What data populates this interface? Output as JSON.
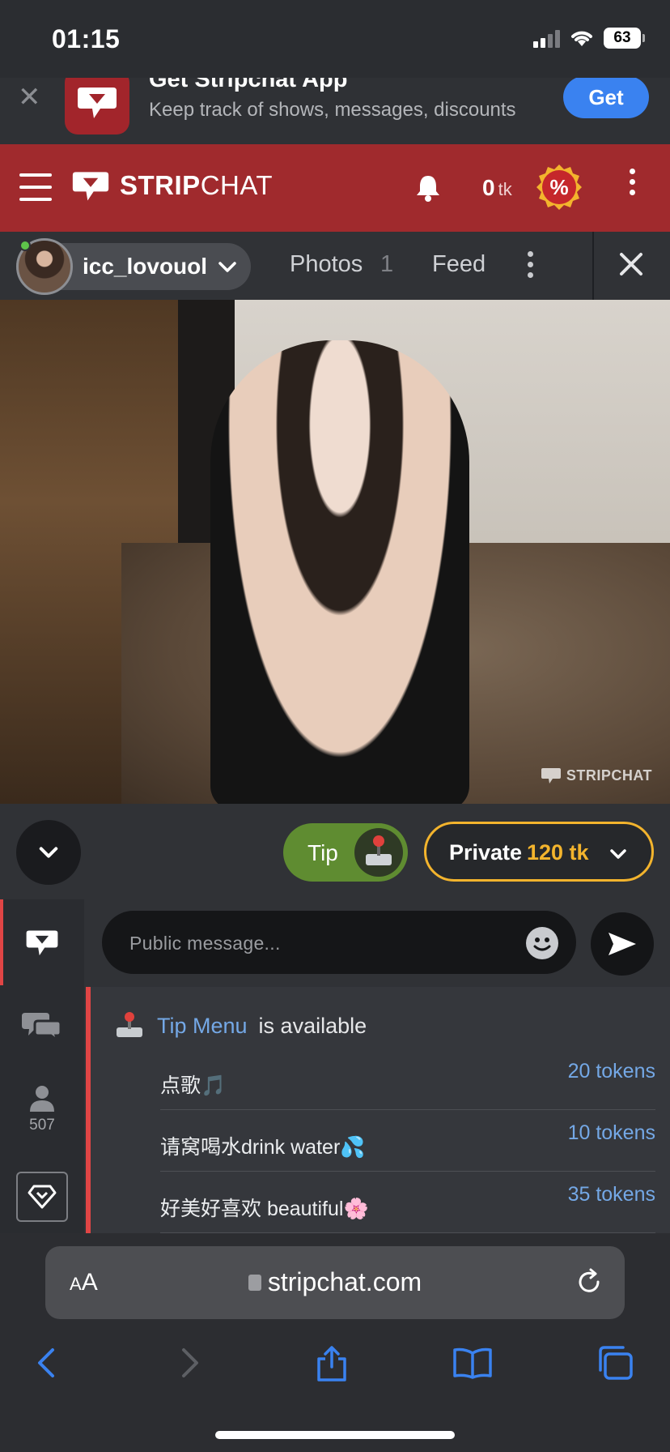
{
  "status_bar": {
    "time": "01:15",
    "battery": "63"
  },
  "app_banner": {
    "close_glyph": "✕",
    "title": "Get Stripchat App",
    "subtitle": "Keep track of shows, messages, discounts",
    "get_label": "Get"
  },
  "header": {
    "brand_bold": "STRIP",
    "brand_rest": "CHAT",
    "tokens_value": "0",
    "tokens_unit": "tk",
    "promo_symbol": "%"
  },
  "model_bar": {
    "model_name": "icc_lovouol",
    "tab_photos": "Photos",
    "tab_photos_count": "1",
    "tab_feed": "Feed"
  },
  "video": {
    "watermark": "STRIPCHAT"
  },
  "actions": {
    "tip_label": "Tip",
    "private_label": "Private",
    "private_price": "120 tk"
  },
  "chat": {
    "users_count": "507",
    "placeholder": "Public message...",
    "tip_menu": {
      "link_text": "Tip Menu",
      "rest_text": "is available",
      "items": [
        {
          "name": "点歌🎵",
          "price": "20 tokens"
        },
        {
          "name": "请窝喝水drink water💦",
          "price": "10 tokens"
        },
        {
          "name": "好美好喜欢 beautiful🌸",
          "price": "35 tokens"
        }
      ]
    }
  },
  "safari": {
    "aa_small": "A",
    "aa_large": "A",
    "url": "stripchat.com"
  },
  "colors": {
    "brand_red": "#a02a2d",
    "tip_green": "#5f8c31",
    "private_gold": "#f3b42d",
    "link_blue": "#74a8e6",
    "ios_blue": "#3a82f0"
  },
  "icons": [
    "close-icon",
    "stripchat-logo-icon",
    "menu-icon",
    "bell-icon",
    "percent-badge-icon",
    "kebab-icon",
    "chevron-down-icon",
    "chat-bubble-icon",
    "private-chat-icon",
    "user-icon",
    "diamond-icon",
    "emoji-icon",
    "send-icon",
    "joystick-icon",
    "reload-icon",
    "back-icon",
    "forward-icon",
    "share-icon",
    "bookmarks-icon",
    "tabs-icon"
  ]
}
